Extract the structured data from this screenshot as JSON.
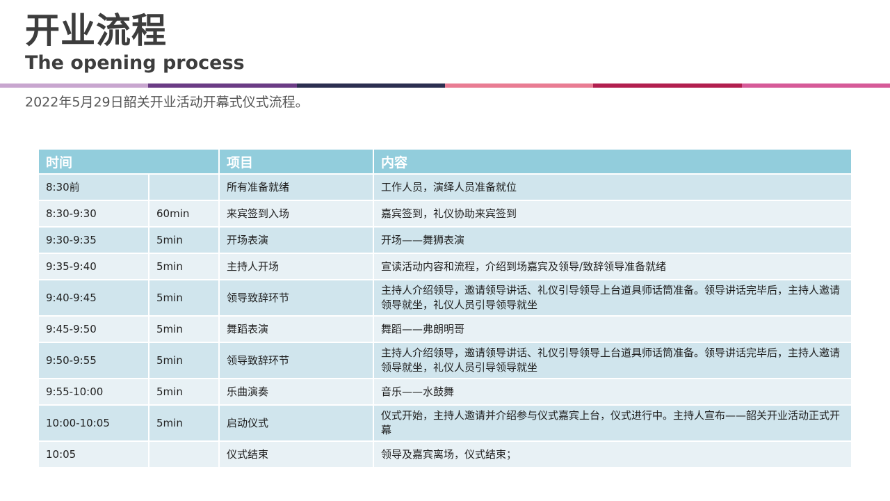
{
  "header": {
    "title_cn": "开业流程",
    "title_en": "The opening process",
    "subtitle": "2022年5月29日韶关开业活动开幕式仪式流程。"
  },
  "color_bar": [
    "#c8a6cf",
    "#6b3c85",
    "#2c2f50",
    "#e97c93",
    "#b21f4f",
    "#d65a98"
  ],
  "table": {
    "headers": [
      "时间",
      "项目",
      "内容"
    ],
    "header_color": "#92cddc",
    "rows": [
      {
        "time": "8:30前",
        "duration": "",
        "item": "所有准备就绪",
        "content": "工作人员，演绎人员准备就位"
      },
      {
        "time": "8:30-9:30",
        "duration": "60min",
        "item": "来宾签到入场",
        "content": "嘉宾签到，礼仪协助来宾签到"
      },
      {
        "time": "9:30-9:35",
        "duration": "5min",
        "item": "开场表演",
        "content": "开场——舞狮表演"
      },
      {
        "time": "9:35-9:40",
        "duration": "5min",
        "item": "主持人开场",
        "content": "宣读活动内容和流程，介绍到场嘉宾及领导/致辞领导准备就绪"
      },
      {
        "time": "9:40-9:45",
        "duration": "5min",
        "item": "领导致辞环节",
        "content": "主持人介绍领导，邀请领导讲话、礼仪引导领导上台道具师话筒准备。领导讲话完毕后，主持人邀请领导就坐，礼仪人员引导领导就坐"
      },
      {
        "time": "9:45-9:50",
        "duration": "5min",
        "item": "舞蹈表演",
        "content": "舞蹈——弗朗明哥"
      },
      {
        "time": "9:50-9:55",
        "duration": "5min",
        "item": "领导致辞环节",
        "content": "主持人介绍领导，邀请领导讲话、礼仪引导领导上台道具师话筒准备。领导讲话完毕后，主持人邀请领导就坐，礼仪人员引导领导就坐"
      },
      {
        "time": "9:55-10:00",
        "duration": "5min",
        "item": "乐曲演奏",
        "content": "音乐——水鼓舞"
      },
      {
        "time": "10:00-10:05",
        "duration": "5min",
        "item": "启动仪式",
        "content": "仪式开始，主持人邀请并介绍参与仪式嘉宾上台，仪式进行中。主持人宣布——韶关开业活动正式开幕"
      },
      {
        "time": "10:05",
        "duration": "",
        "item": "仪式结束",
        "content": "领导及嘉宾离场，仪式结束；"
      }
    ]
  }
}
